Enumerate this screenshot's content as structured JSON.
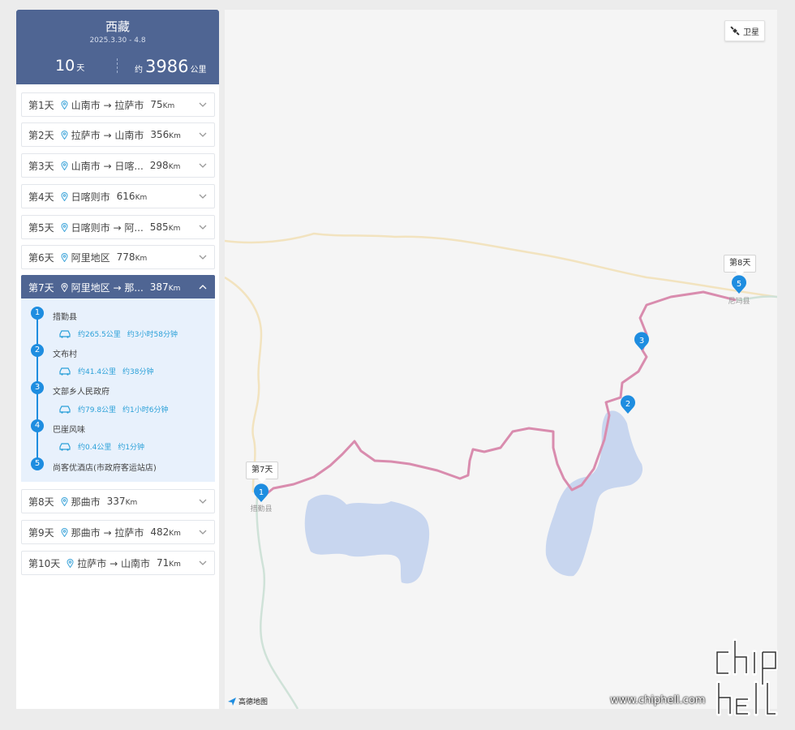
{
  "trip": {
    "title": "西藏",
    "dates": "2025.3.30 - 4.8",
    "days_num": "10",
    "days_unit": "天",
    "dist_prefix": "约",
    "dist_num": "3986",
    "dist_unit": "公里"
  },
  "days": [
    {
      "label": "第1天",
      "route": "山南市 → 拉萨市",
      "km": "75",
      "unit": "Km",
      "expanded": false
    },
    {
      "label": "第2天",
      "route": "拉萨市 → 山南市",
      "km": "356",
      "unit": "Km",
      "expanded": false
    },
    {
      "label": "第3天",
      "route": "山南市 → 日喀...",
      "km": "298",
      "unit": "Km",
      "expanded": false
    },
    {
      "label": "第4天",
      "route": "日喀则市",
      "km": "616",
      "unit": "Km",
      "expanded": false
    },
    {
      "label": "第5天",
      "route": "日喀则市 → 阿...",
      "km": "585",
      "unit": "Km",
      "expanded": false
    },
    {
      "label": "第6天",
      "route": "阿里地区",
      "km": "778",
      "unit": "Km",
      "expanded": false
    },
    {
      "label": "第7天",
      "route": "阿里地区 → 那...",
      "km": "387",
      "unit": "Km",
      "expanded": true
    },
    {
      "label": "第8天",
      "route": "那曲市",
      "km": "337",
      "unit": "Km",
      "expanded": false
    },
    {
      "label": "第9天",
      "route": "那曲市 → 拉萨市",
      "km": "482",
      "unit": "Km",
      "expanded": false
    },
    {
      "label": "第10天",
      "route": "拉萨市 → 山南市",
      "km": "71",
      "unit": "Km",
      "expanded": false
    }
  ],
  "day7_detail": {
    "stops": [
      {
        "num": "1",
        "name": "措勤县"
      },
      {
        "num": "2",
        "name": "文布村"
      },
      {
        "num": "3",
        "name": "文部乡人民政府"
      },
      {
        "num": "4",
        "name": "巴崖风味"
      },
      {
        "num": "5",
        "name": "尚客优酒店(市政府客运站店)"
      }
    ],
    "legs": [
      {
        "distance": "约265.5公里",
        "duration": "约3小时58分钟"
      },
      {
        "distance": "约41.4公里",
        "duration": "约38分钟"
      },
      {
        "distance": "约79.8公里",
        "duration": "约1小时6分钟"
      },
      {
        "distance": "约0.4公里",
        "duration": "约1分钟"
      }
    ]
  },
  "map": {
    "satellite_label": "卫星",
    "tag_start": "第7天",
    "tag_end": "第8天",
    "start_place": "措勤县",
    "end_place": "尼玛县",
    "markers": [
      "1",
      "2",
      "3",
      "5"
    ],
    "provider": "高德地图",
    "route_color": "#d98cae",
    "lake_color": "#c8d6ef",
    "road_color": "#f2e3bf"
  },
  "watermark": {
    "site": "www.chiphell.com"
  }
}
